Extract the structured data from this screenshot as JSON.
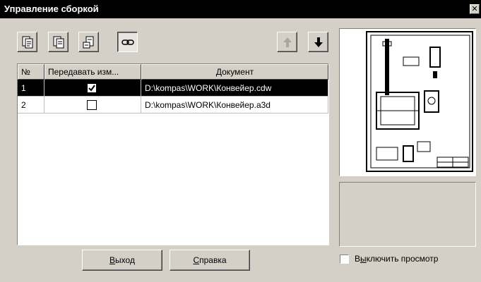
{
  "window": {
    "title": "Управление сборкой",
    "close_glyph": "✕"
  },
  "toolbar": {
    "buttons": [
      {
        "icon": "document-copy-icon"
      },
      {
        "icon": "document-copy-icon"
      },
      {
        "icon": "document-edit-icon"
      },
      {
        "icon": "link-icon",
        "pressed": true
      },
      {
        "icon": "arrow-up-icon",
        "disabled": true
      },
      {
        "icon": "arrow-down-icon"
      }
    ]
  },
  "table": {
    "columns": [
      "№",
      "Передавать изм...",
      "Документ"
    ],
    "rows": [
      {
        "num": "1",
        "checked": true,
        "document": "D:\\kompas\\WORK\\Конвейер.cdw",
        "selected": true
      },
      {
        "num": "2",
        "checked": false,
        "document": "D:\\kompas\\WORK\\Конвейер.a3d",
        "selected": false
      }
    ]
  },
  "buttons": {
    "exit_accel": "В",
    "exit_rest": "ыход",
    "help_accel": "С",
    "help_rest": "правка"
  },
  "preview_toggle": {
    "label_pre": "В",
    "label_accel": "ы",
    "label_rest": "ключить просмотр",
    "checked": false
  },
  "colors": {
    "selection": "#000000",
    "face": "#d4d0c8"
  }
}
